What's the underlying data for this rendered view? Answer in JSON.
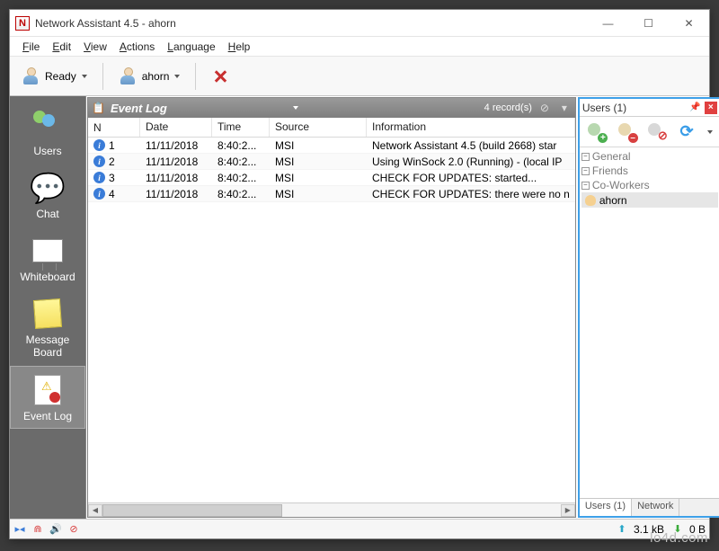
{
  "window": {
    "title": "Network Assistant 4.5 - ahorn"
  },
  "menu": {
    "file": "File",
    "edit": "Edit",
    "view": "View",
    "actions": "Actions",
    "language": "Language",
    "help": "Help"
  },
  "toolbar": {
    "ready": "Ready",
    "user": "ahorn"
  },
  "sidebar": {
    "items": [
      {
        "label": "Users"
      },
      {
        "label": "Chat"
      },
      {
        "label": "Whiteboard"
      },
      {
        "label": "Message Board"
      },
      {
        "label": "Event Log"
      }
    ]
  },
  "event_log": {
    "title": "Event Log",
    "records_label": "4 record(s)",
    "columns": {
      "n": "N",
      "date": "Date",
      "time": "Time",
      "source": "Source",
      "info": "Information"
    },
    "rows": [
      {
        "n": "1",
        "date": "11/11/2018",
        "time": "8:40:2...",
        "source": "MSI",
        "info": "Network Assistant 4.5 (build 2668) star"
      },
      {
        "n": "2",
        "date": "11/11/2018",
        "time": "8:40:2...",
        "source": "MSI",
        "info": "Using WinSock 2.0 (Running) - (local IP"
      },
      {
        "n": "3",
        "date": "11/11/2018",
        "time": "8:40:2...",
        "source": "MSI",
        "info": "CHECK FOR UPDATES: started..."
      },
      {
        "n": "4",
        "date": "11/11/2018",
        "time": "8:40:2...",
        "source": "MSI",
        "info": "CHECK FOR UPDATES: there were no n"
      }
    ]
  },
  "users_panel": {
    "title": "Users (1)",
    "groups": [
      {
        "label": "General"
      },
      {
        "label": "Friends"
      },
      {
        "label": "Co-Workers"
      }
    ],
    "user": "ahorn",
    "tabs": {
      "users": "Users (1)",
      "network": "Network"
    }
  },
  "status": {
    "up": "3.1 kB",
    "down": "0 B"
  },
  "watermark": "lo4d.com"
}
